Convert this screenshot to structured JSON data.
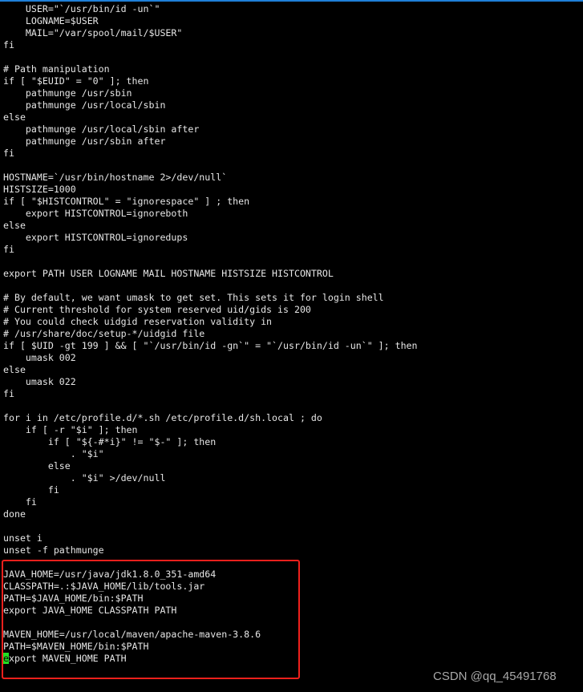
{
  "terminal": {
    "lines": [
      "    USER=\"`/usr/bin/id -un`\"",
      "    LOGNAME=$USER",
      "    MAIL=\"/var/spool/mail/$USER\"",
      "fi",
      "",
      "# Path manipulation",
      "if [ \"$EUID\" = \"0\" ]; then",
      "    pathmunge /usr/sbin",
      "    pathmunge /usr/local/sbin",
      "else",
      "    pathmunge /usr/local/sbin after",
      "    pathmunge /usr/sbin after",
      "fi",
      "",
      "HOSTNAME=`/usr/bin/hostname 2>/dev/null`",
      "HISTSIZE=1000",
      "if [ \"$HISTCONTROL\" = \"ignorespace\" ] ; then",
      "    export HISTCONTROL=ignoreboth",
      "else",
      "    export HISTCONTROL=ignoredups",
      "fi",
      "",
      "export PATH USER LOGNAME MAIL HOSTNAME HISTSIZE HISTCONTROL",
      "",
      "# By default, we want umask to get set. This sets it for login shell",
      "# Current threshold for system reserved uid/gids is 200",
      "# You could check uidgid reservation validity in",
      "# /usr/share/doc/setup-*/uidgid file",
      "if [ $UID -gt 199 ] && [ \"`/usr/bin/id -gn`\" = \"`/usr/bin/id -un`\" ]; then",
      "    umask 002",
      "else",
      "    umask 022",
      "fi",
      "",
      "for i in /etc/profile.d/*.sh /etc/profile.d/sh.local ; do",
      "    if [ -r \"$i\" ]; then",
      "        if [ \"${-#*i}\" != \"$-\" ]; then",
      "            . \"$i\"",
      "        else",
      "            . \"$i\" >/dev/null",
      "        fi",
      "    fi",
      "done",
      "",
      "unset i",
      "unset -f pathmunge",
      "",
      "JAVA_HOME=/usr/java/jdk1.8.0_351-amd64",
      "CLASSPATH=.:$JAVA_HOME/lib/tools.jar",
      "PATH=$JAVA_HOME/bin:$PATH",
      "export JAVA_HOME CLASSPATH PATH",
      "",
      "MAVEN_HOME=/usr/local/maven/apache-maven-3.8.6",
      "PATH=$MAVEN_HOME/bin:$PATH"
    ],
    "cursor_line": {
      "cursor_char": "e",
      "rest": "xport MAVEN_HOME PATH"
    },
    "cursor_color": "#22e022",
    "highlight_color": "#f0201c"
  },
  "watermark": "CSDN @qq_45491768"
}
